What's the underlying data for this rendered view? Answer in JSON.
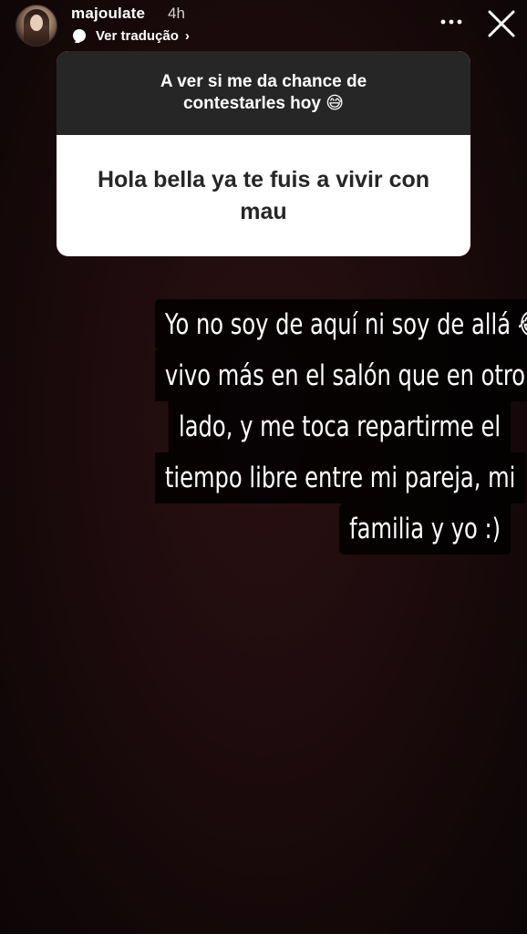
{
  "header": {
    "username": "majoulate",
    "time": "4h",
    "translate_label": "Ver tradução",
    "translate_chevron": "›",
    "more_icon": "more-dots-icon",
    "close_icon": "close-icon"
  },
  "question_sticker": {
    "prompt": "A ver si me da chance de contestarles hoy 😅",
    "question": "Hola bella ya te fuis a vivir con mau"
  },
  "answer": {
    "lines": [
      "Yo no soy de aquí ni soy de allá 😂",
      "vivo más en el salón que en otro",
      "lado, y me toca repartirme el",
      "tiempo libre entre mi pareja, mi",
      "familia  y yo :)"
    ]
  },
  "colors": {
    "background": "#1d0b0d",
    "sticker_header": "#262626",
    "sticker_body": "#ffffff"
  }
}
